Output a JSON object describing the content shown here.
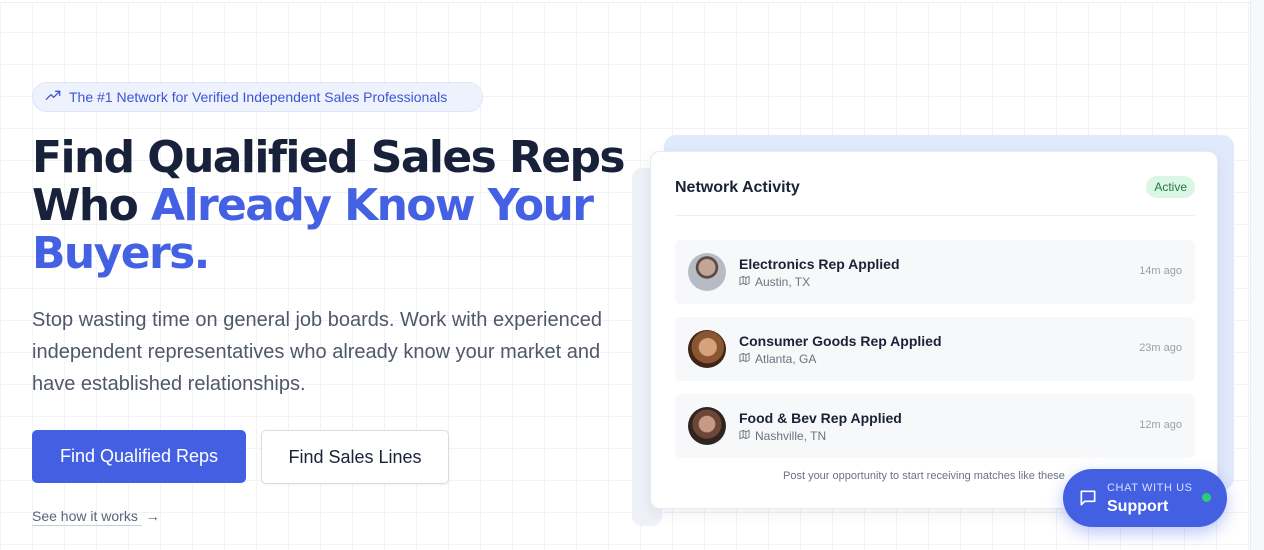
{
  "hero": {
    "badge_text": "The #1 Network for Verified Independent Sales Professionals",
    "headline_line1": "Find Qualified Sales Reps",
    "headline_line2_plain": "Who ",
    "headline_line2_accent": "Already Know Your",
    "headline_line3_accent": "Buyers.",
    "subtext": "Stop wasting time on general job boards. Work with experienced independent representatives who already know your market and have established relationships.",
    "primary_button": "Find Qualified Reps",
    "secondary_button": "Find Sales Lines",
    "see_how_link": "See how it works",
    "see_how_arrow": "→"
  },
  "activity_card": {
    "title": "Network Activity",
    "status": "Active",
    "items": [
      {
        "title": "Electronics Rep Applied",
        "location": "Austin, TX",
        "time": "14m ago"
      },
      {
        "title": "Consumer Goods Rep Applied",
        "location": "Atlanta, GA",
        "time": "23m ago"
      },
      {
        "title": "Food & Bev Rep Applied",
        "location": "Nashville, TN",
        "time": "12m ago"
      }
    ],
    "footer": "Post your opportunity to start receiving matches like these"
  },
  "chat": {
    "label_small": "CHAT WITH US",
    "label_big": "Support"
  },
  "colors": {
    "accent": "#4360e3",
    "headline": "#17213a",
    "status_green": "#1f7a43",
    "online_dot": "#2ecc71"
  },
  "icons": [
    "trending-up-icon",
    "map-icon",
    "chat-bubble-icon",
    "arrow-right-icon"
  ]
}
